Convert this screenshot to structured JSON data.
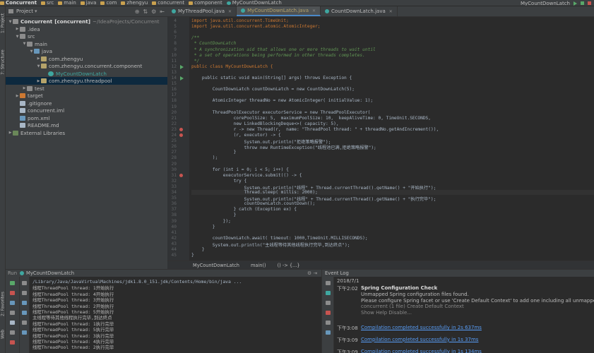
{
  "navbar": {
    "crumbs": [
      "Concurrent",
      "src",
      "main",
      "java",
      "com",
      "zhengyu",
      "concurrent",
      "component",
      "MyCountDownLatch"
    ],
    "run_config": "MyCountDownLatch"
  },
  "left_strip": {
    "project_tab": "1: Project",
    "structure_tab": "7: Structure",
    "favorites_tab": "2: Favorites",
    "web_tab": "Web"
  },
  "project": {
    "title": "Project",
    "tree": [
      {
        "label": "Concurrent",
        "extra": "[concurrent]",
        "hint": "~/IdeaProjects/Concurrent",
        "indent": 0,
        "arrow": "▼",
        "icon": "folder"
      },
      {
        "label": ".idea",
        "indent": 1,
        "arrow": "▶",
        "icon": "folder"
      },
      {
        "label": "src",
        "indent": 1,
        "arrow": "▼",
        "icon": "folder"
      },
      {
        "label": "main",
        "indent": 2,
        "arrow": "▼",
        "icon": "folder"
      },
      {
        "label": "java",
        "indent": 3,
        "arrow": "▼",
        "icon": "blue"
      },
      {
        "label": "com.zhengyu",
        "indent": 4,
        "arrow": "▶",
        "icon": "pkg"
      },
      {
        "label": "com.zhengyu.concurrent.component",
        "indent": 4,
        "arrow": "▼",
        "icon": "pkg"
      },
      {
        "label": "MyCountDownLatch",
        "indent": 5,
        "arrow": "",
        "icon": "class"
      },
      {
        "label": "com.zhengyu.threadpool",
        "indent": 4,
        "arrow": "▶",
        "icon": "pkg",
        "selected": true
      },
      {
        "label": "test",
        "indent": 2,
        "arrow": "▶",
        "icon": "folder"
      },
      {
        "label": "target",
        "indent": 1,
        "arrow": "▶",
        "icon": "orange"
      },
      {
        "label": ".gitignore",
        "indent": 1,
        "arrow": "",
        "icon": "file"
      },
      {
        "label": "concurrent.iml",
        "indent": 1,
        "arrow": "",
        "icon": "file"
      },
      {
        "label": "pom.xml",
        "indent": 1,
        "arrow": "",
        "icon": "blue"
      },
      {
        "label": "README.md",
        "indent": 1,
        "arrow": "",
        "icon": "file"
      },
      {
        "label": "External Libraries",
        "indent": 0,
        "arrow": "▶",
        "icon": "lib"
      }
    ]
  },
  "tabs": [
    {
      "label": "MyThreadPool.java"
    },
    {
      "label": "MyCountDownLatch.java",
      "active": true
    },
    {
      "label": "CountDownLatch.java"
    }
  ],
  "editor": {
    "lines": [
      {
        "n": "4",
        "t": "import java.util.concurrent.TimeUnit;",
        "c": "kw"
      },
      {
        "n": "5",
        "t": "import java.util.concurrent.atomic.AtomicInteger;",
        "c": "kw"
      },
      {
        "n": "6",
        "t": ""
      },
      {
        "n": "7",
        "t": "/**",
        "c": "cm"
      },
      {
        "n": "8",
        "t": " * CountDownLatch",
        "c": "cm"
      },
      {
        "n": "9",
        "t": " * A synchronization aid that allows one or more threads to wait until",
        "c": "cm"
      },
      {
        "n": "10",
        "t": " * a set of operations being performed in other threads completes.",
        "c": "cm"
      },
      {
        "n": "11",
        "t": " */",
        "c": "cm"
      },
      {
        "n": "12",
        "t": "public class MyCountDownLatch {",
        "c": "kw",
        "mark": "run"
      },
      {
        "n": "13",
        "t": ""
      },
      {
        "n": "14",
        "t": "    public static void main(String[] args) throws Exception {",
        "mark": "run"
      },
      {
        "n": "15",
        "t": ""
      },
      {
        "n": "16",
        "t": "        CountDownLatch countDownLatch = new CountDownLatch(5);"
      },
      {
        "n": "17",
        "t": ""
      },
      {
        "n": "18",
        "t": "        AtomicInteger threadNo = new AtomicInteger( initialValue: 1);"
      },
      {
        "n": "19",
        "t": ""
      },
      {
        "n": "20",
        "t": "        ThreadPoolExecutor executorService = new ThreadPoolExecutor("
      },
      {
        "n": "21",
        "t": "                corePoolSize: 5,  maximumPoolSize: 10,  keepAliveTime: 0, TimeUnit.SECONDS,"
      },
      {
        "n": "22",
        "t": "                new LinkedBlockingDeque<>( capacity: 5),"
      },
      {
        "n": "23",
        "t": "                r -> new Thread(r,  name: \"ThreadPool thread: \" + threadNo.getAndIncrement()),",
        "mark": "bp"
      },
      {
        "n": "24",
        "t": "                (r, executor) -> {",
        "mark": "bp"
      },
      {
        "n": "25",
        "t": "                    System.out.println(\"拒绝策略报警\");"
      },
      {
        "n": "26",
        "t": "                    throw new RuntimeException(\"线程池已满,拒绝策略报警\");"
      },
      {
        "n": "27",
        "t": "                }"
      },
      {
        "n": "28",
        "t": "        );"
      },
      {
        "n": "29",
        "t": ""
      },
      {
        "n": "30",
        "t": "        for (int i = 0; i < 5; i++) {"
      },
      {
        "n": "31",
        "t": "            executorService.submit(() -> {",
        "mark": "bp"
      },
      {
        "n": "32",
        "t": "                try {"
      },
      {
        "n": "33",
        "t": "                    System.out.println(\"线程\" + Thread.currentThread().getName() + \"开始执行\");"
      },
      {
        "n": "34",
        "t": "                    Thread.sleep( millis: 2000);",
        "cur": true
      },
      {
        "n": "35",
        "t": "                    System.out.println(\"线程\" + Thread.currentThread().getName() + \"执行完毕\");"
      },
      {
        "n": "36",
        "t": "                    countDownLatch.countDown();"
      },
      {
        "n": "37",
        "t": "                } catch (Exception ex) {"
      },
      {
        "n": "38",
        "t": "                }"
      },
      {
        "n": "39",
        "t": "            });"
      },
      {
        "n": "40",
        "t": "        }"
      },
      {
        "n": "41",
        "t": ""
      },
      {
        "n": "42",
        "t": "        countDownLatch.await( timeout: 1000,TimeUnit.MILLISECONDS);"
      },
      {
        "n": "43",
        "t": "        System.out.println(\"主线程等待其他线程执行完毕,到达终点\");"
      },
      {
        "n": "44",
        "t": "    }"
      },
      {
        "n": "45",
        "t": "}"
      }
    ],
    "status": [
      "MyCountDownLatch",
      "main()",
      "() -> {...}"
    ]
  },
  "run": {
    "label": "Run",
    "config": "MyCountDownLatch",
    "console": [
      "/Library/Java/JavaVirtualMachines/jdk1.8.0_151.jdk/Contents/Home/bin/java ...",
      "线程ThreadPool thread: 1开始执行",
      "线程ThreadPool thread: 4开始执行",
      "线程ThreadPool thread: 3开始执行",
      "线程ThreadPool thread: 2开始执行",
      "线程ThreadPool thread: 5开始执行",
      "主线程等待其他线程执行完毕,到达终点",
      "线程ThreadPool thread: 1执行完毕",
      "线程ThreadPool thread: 5执行完毕",
      "线程ThreadPool thread: 3执行完毕",
      "线程ThreadPool thread: 4执行完毕",
      "线程ThreadPool thread: 2执行完毕"
    ]
  },
  "event_log": {
    "title": "Event Log",
    "date": "2018/7/1",
    "entries": [
      {
        "time": "下午2:02",
        "lines": [
          "Spring Configuration Check",
          "Unmapped Spring configuration files found.",
          "Please configure Spring facet or use 'Create Default Context' to add one including all unmapped",
          "concurrent (1 file)   Create Default Context",
          "Show Help Disable..."
        ]
      },
      {
        "time": "下午3:08",
        "lines": [
          "Compilation completed successfully in 2s 637ms"
        ]
      },
      {
        "time": "下午3:09",
        "lines": [
          "Compilation completed successfully in 1s 37ms"
        ]
      },
      {
        "time": "下午3:09",
        "lines": [
          "Compilation completed successfully in 1s 134ms"
        ]
      }
    ]
  }
}
